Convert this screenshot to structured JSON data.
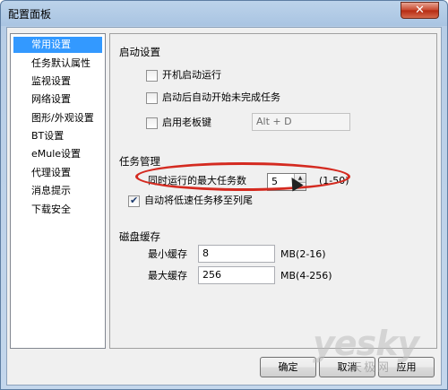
{
  "window": {
    "title": "配置面板",
    "close_symbol": "✕"
  },
  "nav": {
    "items": [
      {
        "label": "常用设置",
        "selected": true
      },
      {
        "label": "任务默认属性"
      },
      {
        "label": "监视设置"
      },
      {
        "label": "网络设置"
      },
      {
        "label": "图形/外观设置"
      },
      {
        "label": "BT设置"
      },
      {
        "label": "eMule设置"
      },
      {
        "label": "代理设置"
      },
      {
        "label": "消息提示"
      },
      {
        "label": "下载安全"
      }
    ]
  },
  "startup": {
    "title": "启动设置",
    "options": [
      {
        "label": "开机启动运行",
        "checked": false
      },
      {
        "label": "启动后自动开始未完成任务",
        "checked": false
      },
      {
        "label": "启用老板键",
        "checked": false
      }
    ],
    "boss_key_value": "Alt + D"
  },
  "task": {
    "title": "任务管理",
    "max_tasks_label": "同时运行的最大任务数",
    "max_tasks_value": "5",
    "max_tasks_range": "(1-50)",
    "auto_move_label": "自动将低速任务移至列尾",
    "auto_move_checked": true
  },
  "cache": {
    "title": "磁盘缓存",
    "min_label": "最小缓存",
    "min_value": "8",
    "min_unit": "MB(2-16)",
    "max_label": "最大缓存",
    "max_value": "256",
    "max_unit": "MB(4-256)"
  },
  "buttons": {
    "ok": "确定",
    "cancel": "取消",
    "apply": "应用"
  },
  "watermark": {
    "brand": "yesky",
    "sub": "天极网"
  },
  "colors": {
    "selection": "#3399ff",
    "highlight_oval": "#d42a20"
  }
}
